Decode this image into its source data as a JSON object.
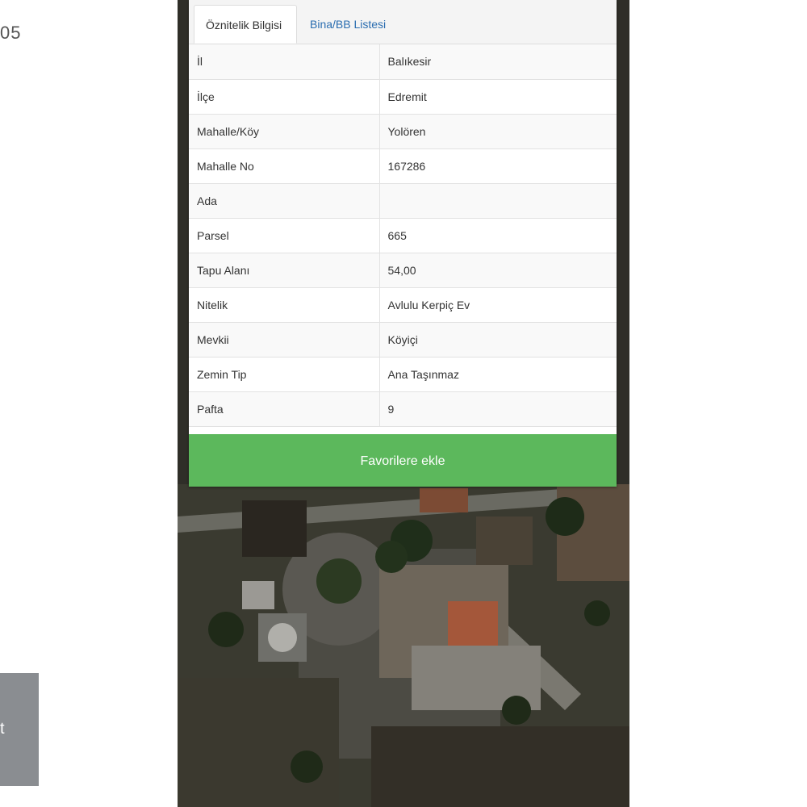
{
  "page": {
    "number_text": "05",
    "side_button_text": "t"
  },
  "panel": {
    "tabs": [
      {
        "label": "Öznitelik Bilgisi",
        "active": true
      },
      {
        "label": "Bina/BB Listesi",
        "active": false
      }
    ],
    "rows": [
      {
        "key": "İl",
        "value": "Balıkesir"
      },
      {
        "key": "İlçe",
        "value": "Edremit"
      },
      {
        "key": "Mahalle/Köy",
        "value": "Yolören"
      },
      {
        "key": "Mahalle No",
        "value": "167286"
      },
      {
        "key": "Ada",
        "value": ""
      },
      {
        "key": "Parsel",
        "value": "665"
      },
      {
        "key": "Tapu Alanı",
        "value": "54,00"
      },
      {
        "key": "Nitelik",
        "value": "Avlulu Kerpiç Ev"
      },
      {
        "key": "Mevkii",
        "value": "Köyiçi"
      },
      {
        "key": "Zemin Tip",
        "value": "Ana Taşınmaz"
      },
      {
        "key": "Pafta",
        "value": "9"
      }
    ],
    "favorite_button_label": "Favorilere ekle"
  },
  "colors": {
    "accent_green": "#5cb85c",
    "tab_link": "#2a6db0",
    "map_dark": "#2b2a25"
  }
}
